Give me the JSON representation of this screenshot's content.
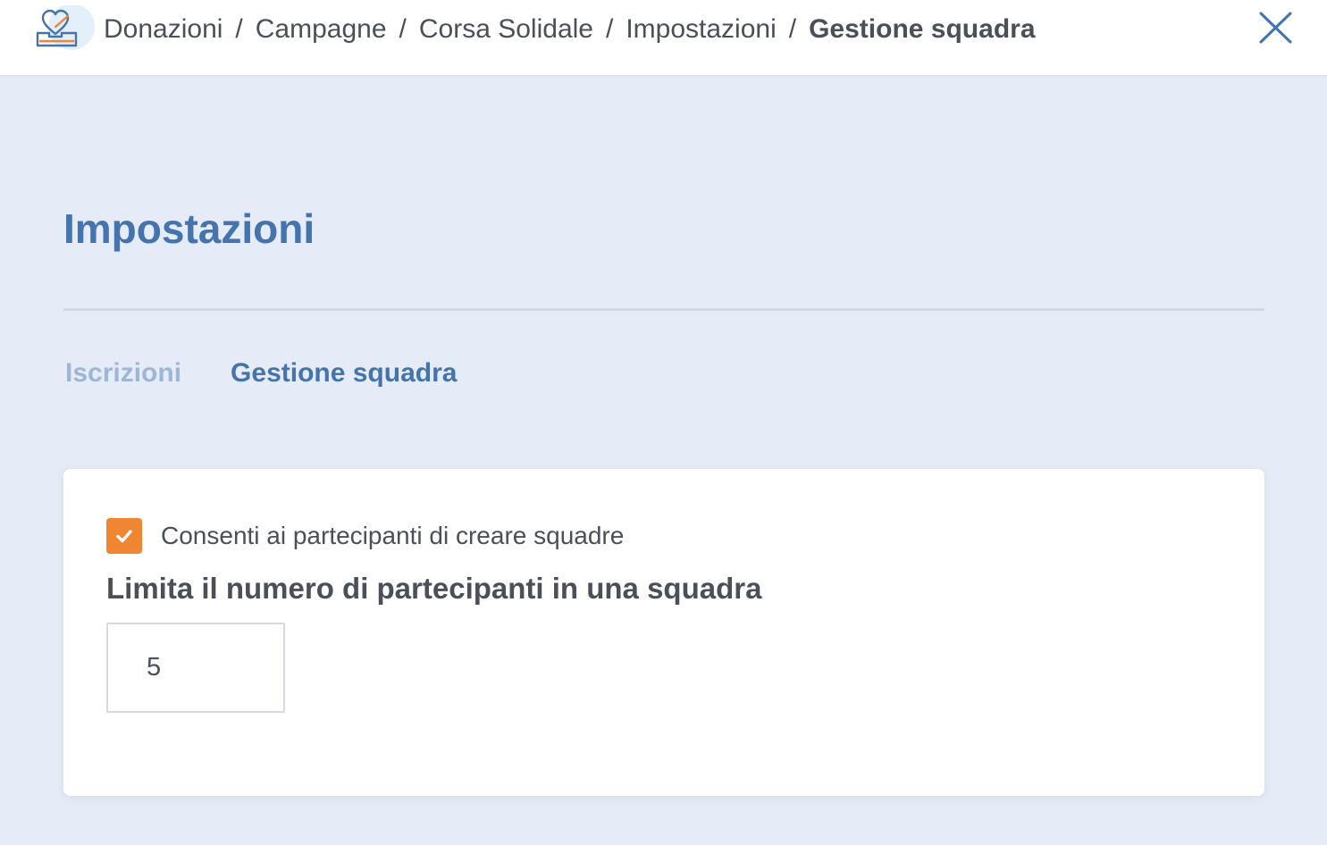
{
  "header": {
    "logo_icon": "donation-heart-box-icon",
    "breadcrumb": [
      {
        "label": "Donazioni"
      },
      {
        "label": "Campagne"
      },
      {
        "label": "Corsa Solidale"
      },
      {
        "label": "Impostazioni"
      }
    ],
    "current": "Gestione squadra",
    "separator": "/",
    "close_icon": "close-icon"
  },
  "main": {
    "title": "Impostazioni",
    "tabs": [
      {
        "label": "Iscrizioni",
        "active": false
      },
      {
        "label": "Gestione squadra",
        "active": true
      }
    ]
  },
  "card": {
    "allow_teams": {
      "label": "Consenti ai partecipanti di creare squadre",
      "checked": true
    },
    "limit": {
      "label": "Limita il numero di partecipanti in una squadra",
      "value": "5"
    }
  },
  "colors": {
    "accent_blue": "#4473ad",
    "tab_inactive": "#9db6d8",
    "checkbox_orange": "#f08532",
    "page_background": "#e5ecf7",
    "text": "#4a4f58"
  }
}
